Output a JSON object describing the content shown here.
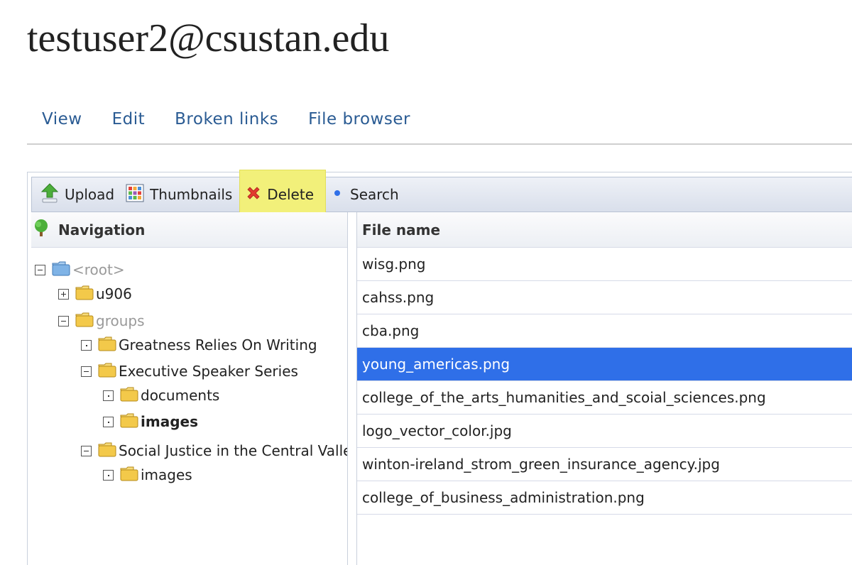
{
  "page": {
    "title": "testuser2@csustan.edu"
  },
  "tabs": [
    {
      "label": "View"
    },
    {
      "label": "Edit"
    },
    {
      "label": "Broken links"
    },
    {
      "label": "File browser"
    }
  ],
  "toolbar": {
    "upload_label": "Upload",
    "thumbnails_label": "Thumbnails",
    "delete_label": "Delete",
    "search_label": "Search"
  },
  "navigation": {
    "header": "Navigation",
    "tree": [
      {
        "label": "<root>",
        "depth": 0,
        "toggle": "minus",
        "icon": "folder-blue-icon",
        "style": "muted"
      },
      {
        "label": "u906",
        "depth": 1,
        "toggle": "plus",
        "icon": "folder-icon",
        "style": "normal"
      },
      {
        "label": "groups",
        "depth": 1,
        "toggle": "minus",
        "icon": "folder-icon",
        "style": "muted"
      },
      {
        "label": "Greatness Relies On Writing",
        "depth": 2,
        "toggle": "dot",
        "icon": "folder-icon",
        "style": "normal"
      },
      {
        "label": "Executive Speaker Series",
        "depth": 2,
        "toggle": "minus",
        "icon": "folder-icon",
        "style": "normal"
      },
      {
        "label": "documents",
        "depth": 3,
        "toggle": "dot",
        "icon": "folder-icon",
        "style": "normal"
      },
      {
        "label": "images",
        "depth": 3,
        "toggle": "dot",
        "icon": "folder-icon",
        "style": "bold"
      },
      {
        "label": "Social Justice in the Central Valley",
        "depth": 2,
        "toggle": "minus",
        "icon": "folder-icon",
        "style": "normal"
      },
      {
        "label": "images",
        "depth": 3,
        "toggle": "dot",
        "icon": "folder-icon",
        "style": "normal"
      }
    ]
  },
  "files": {
    "header": "File name",
    "selected_index": 3,
    "rows": [
      "wisg.png",
      "cahss.png",
      "cba.png",
      "young_americas.png",
      "college_of_the_arts_humanities_and_scoial_sciences.png",
      "logo_vector_color.jpg",
      "winton-ireland_strom_green_insurance_agency.jpg",
      "college_of_business_administration.png"
    ]
  },
  "colors": {
    "link": "#2a5b93",
    "selected_row": "#2f6fe8",
    "delete_highlight": "#f2f07a"
  }
}
